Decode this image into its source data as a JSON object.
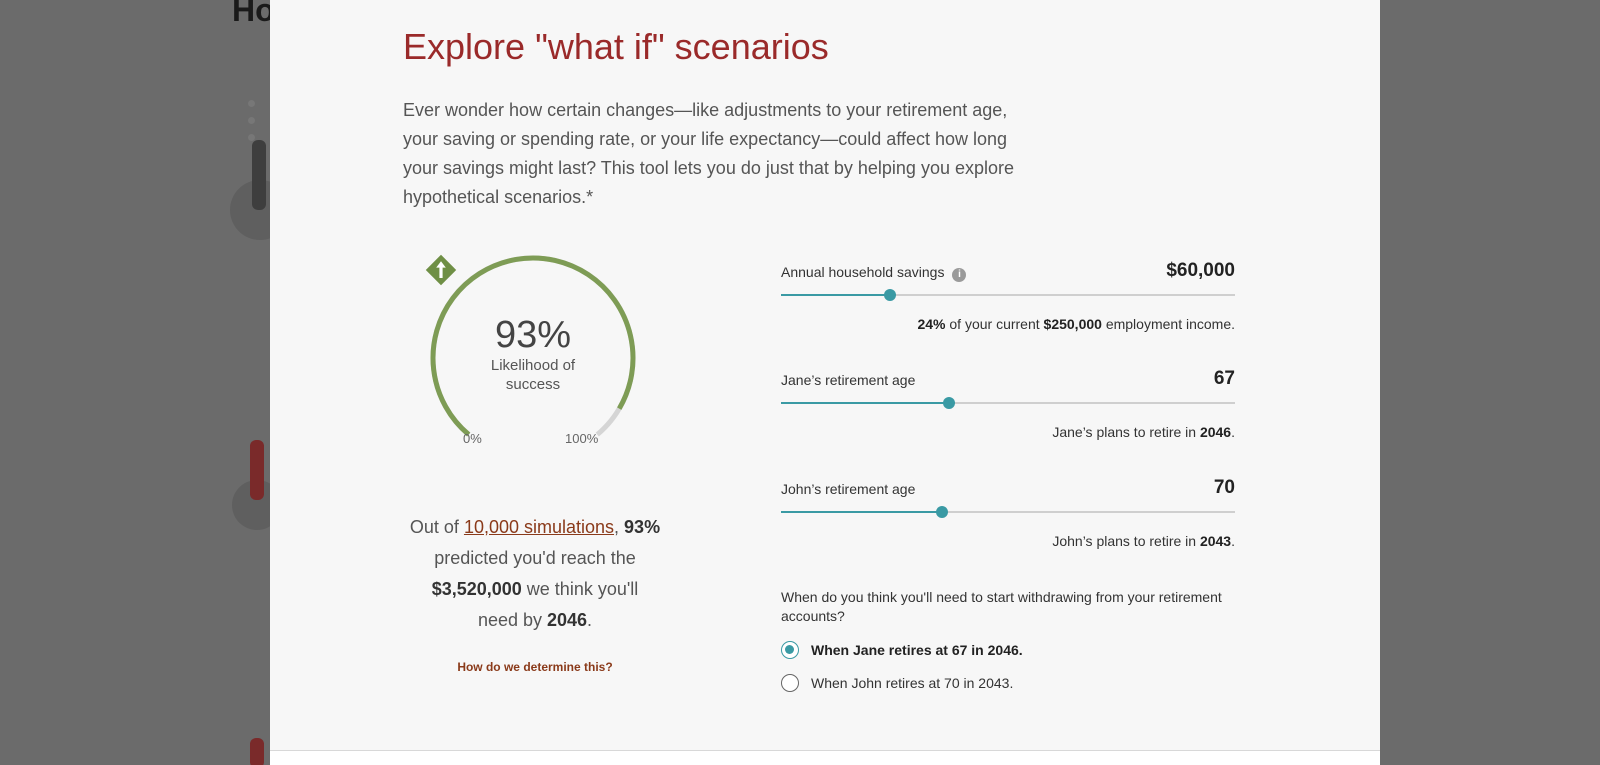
{
  "background": {
    "heading": "Ho"
  },
  "modal": {
    "title": "Explore \"what if\" scenarios",
    "intro": "Ever wonder how certain changes—like adjustments to your retirement age, your saving or spending rate, or your life expectancy—could affect how long your savings might last? This tool lets you do just that by helping you explore hypothetical scenarios.*",
    "nav": {
      "prev_icon": "chevron-left-icon",
      "next_icon": "chevron-right-icon"
    }
  },
  "gauge": {
    "percent_label": "93%",
    "percent_value": 0.93,
    "label_line1": "Likelihood of",
    "label_line2": "success",
    "min_label": "0%",
    "max_label": "100%",
    "badge_icon": "arrow-up-icon",
    "colors": {
      "fill": "#7e9c55",
      "track": "#d5d5d5",
      "badge": "#6f8f45"
    }
  },
  "summary": {
    "prefix": "Out of ",
    "simulations_link": "10,000 simulations",
    "comma": ", ",
    "percent": "93%",
    "line2": "predicted you'd reach the",
    "amount": "$3,520,000",
    "line3_suffix": " we think you'll",
    "line4_prefix": "need by ",
    "year": "2046",
    "period": ".",
    "how_link": "How do we determine this?"
  },
  "sliders": {
    "savings": {
      "label": "Annual household savings",
      "value": "$60,000",
      "position": 0.24,
      "note_pct": "24%",
      "note_mid": " of your current ",
      "note_income": "$250,000",
      "note_end": " employment income."
    },
    "jane": {
      "label": "Jane’s retirement age",
      "value": "67",
      "position": 0.37,
      "note_prefix": "Jane’s plans to retire in ",
      "note_year": "2046",
      "note_end": "."
    },
    "john": {
      "label": "John’s retirement age",
      "value": "70",
      "position": 0.355,
      "note_prefix": "John’s plans to retire in ",
      "note_year": "2043",
      "note_end": "."
    }
  },
  "withdrawal": {
    "question": "When do you think you'll need to start withdrawing from your retirement accounts?",
    "options": [
      {
        "label": "When Jane retires at 67 in 2046.",
        "selected": true
      },
      {
        "label": "When John retires at 70 in 2043.",
        "selected": false
      }
    ]
  },
  "colors": {
    "accent": "#3a9aa4",
    "title": "#9a2a2a",
    "link": "#8a3a1a"
  }
}
